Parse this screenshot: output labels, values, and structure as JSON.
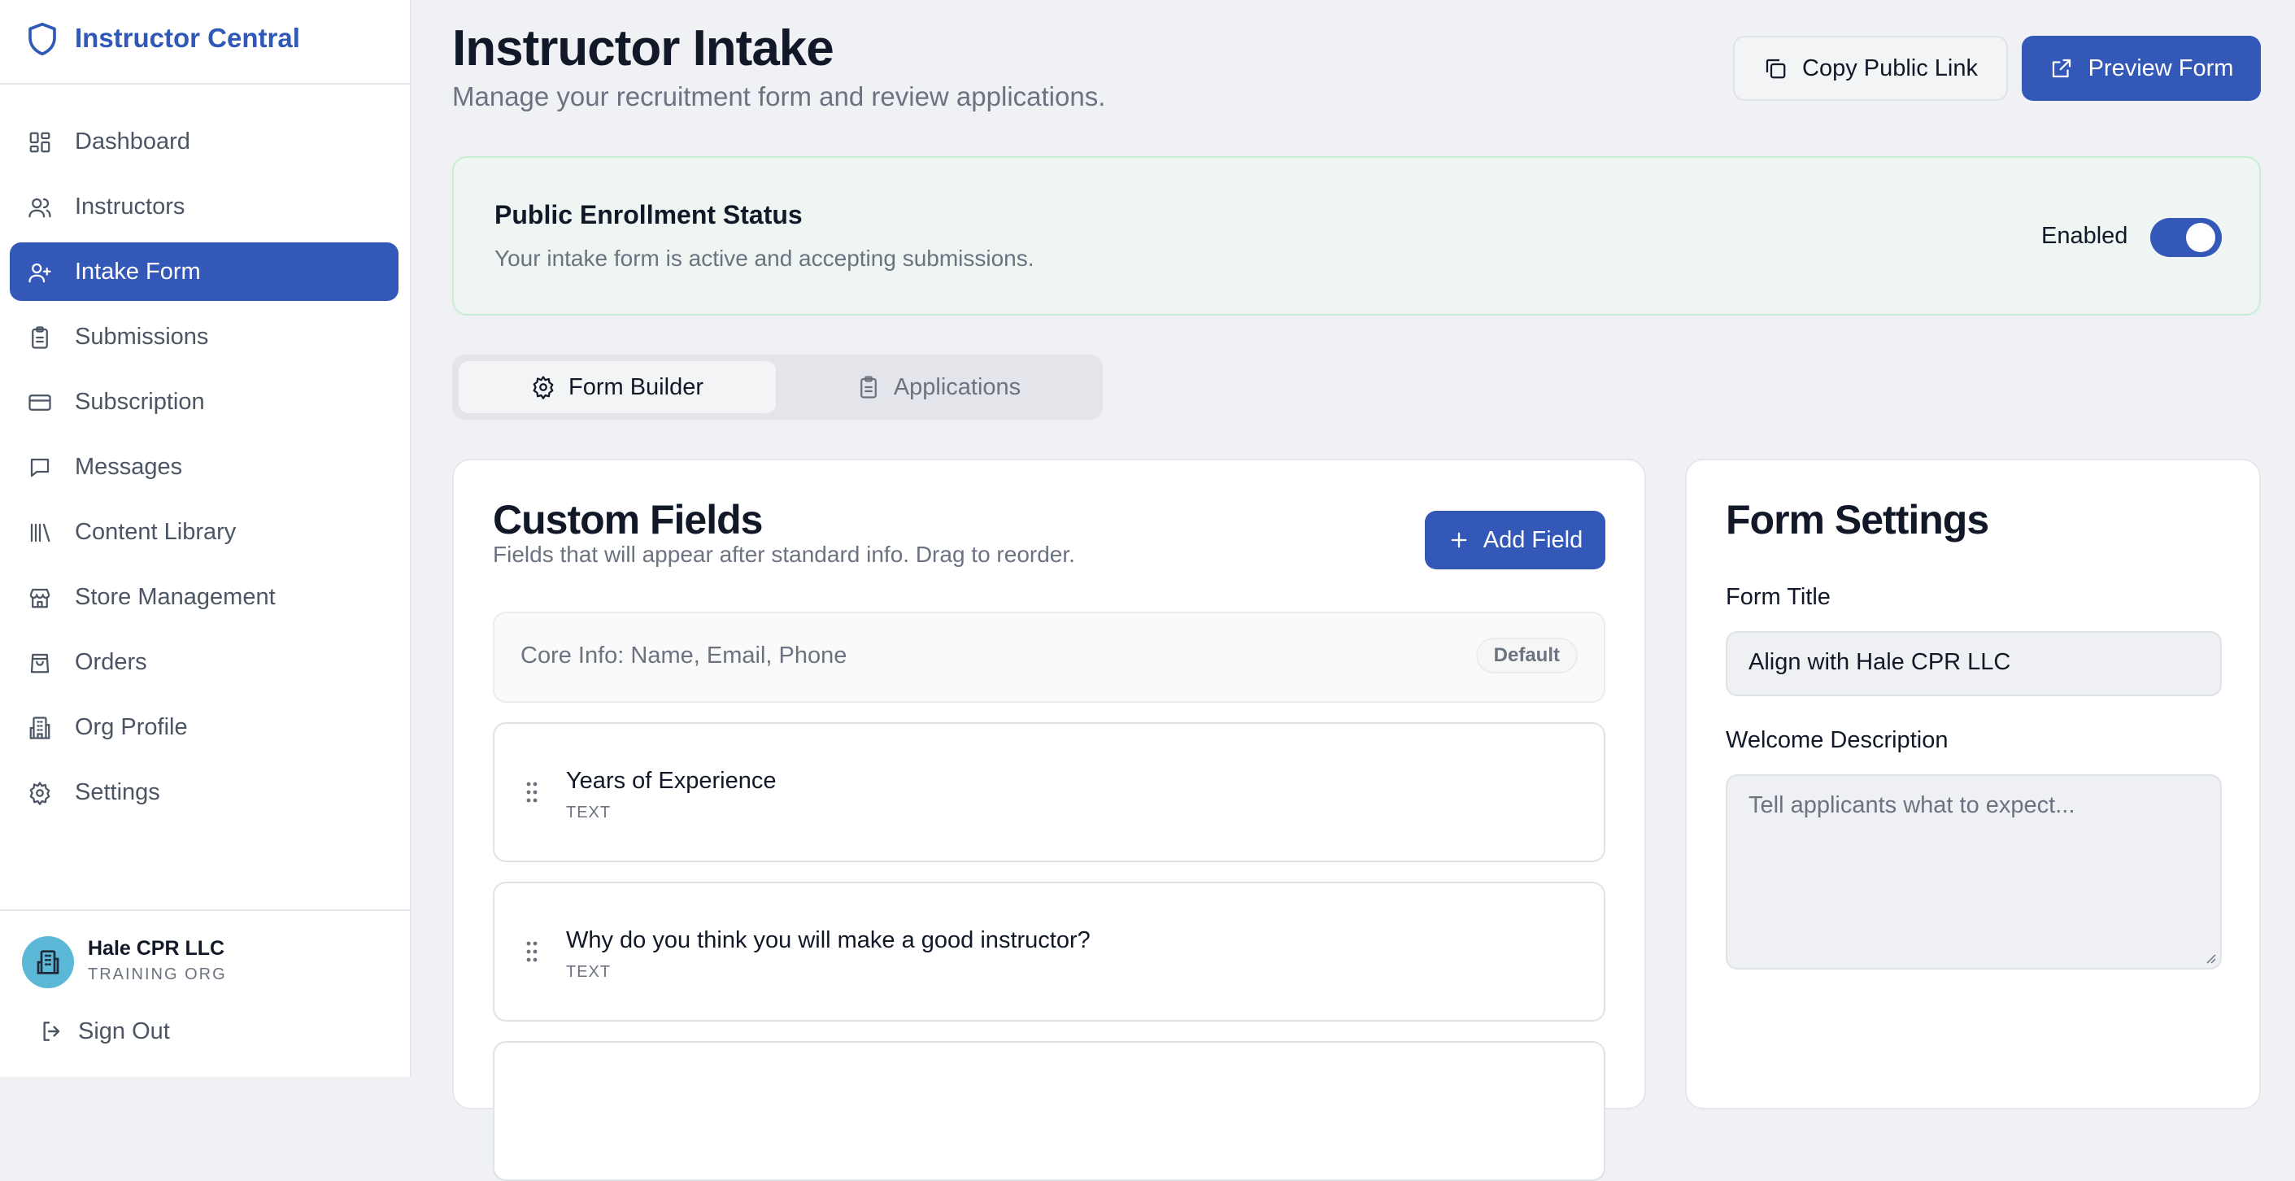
{
  "brand": {
    "name": "Instructor Central"
  },
  "sidebar": {
    "items": [
      {
        "label": "Dashboard",
        "icon": "dashboard-icon",
        "active": false
      },
      {
        "label": "Instructors",
        "icon": "users-icon",
        "active": false
      },
      {
        "label": "Intake Form",
        "icon": "user-plus-icon",
        "active": true
      },
      {
        "label": "Submissions",
        "icon": "clipboard-icon",
        "active": false
      },
      {
        "label": "Subscription",
        "icon": "credit-card-icon",
        "active": false
      },
      {
        "label": "Messages",
        "icon": "message-icon",
        "active": false
      },
      {
        "label": "Content Library",
        "icon": "library-icon",
        "active": false
      },
      {
        "label": "Store Management",
        "icon": "store-icon",
        "active": false
      },
      {
        "label": "Orders",
        "icon": "shopping-bag-icon",
        "active": false
      },
      {
        "label": "Org Profile",
        "icon": "building-icon",
        "active": false
      },
      {
        "label": "Settings",
        "icon": "gear-icon",
        "active": false
      }
    ],
    "org": {
      "name": "Hale CPR LLC",
      "type": "TRAINING ORG"
    },
    "sign_out": "Sign Out"
  },
  "header": {
    "title": "Instructor Intake",
    "subtitle": "Manage your recruitment form and review applications.",
    "copy_link": "Copy Public Link",
    "preview": "Preview Form"
  },
  "status": {
    "title": "Public Enrollment Status",
    "description": "Your intake form is active and accepting submissions.",
    "toggle_label": "Enabled",
    "enabled": true
  },
  "tabs": [
    {
      "label": "Form Builder",
      "active": true
    },
    {
      "label": "Applications",
      "active": false
    }
  ],
  "fields_card": {
    "title": "Custom Fields",
    "subtitle": "Fields that will appear after standard info. Drag to reorder.",
    "add_button": "Add Field",
    "core": {
      "text": "Core Info: Name, Email, Phone",
      "badge": "Default"
    },
    "fields": [
      {
        "label": "Years of Experience",
        "type": "TEXT"
      },
      {
        "label": "Why do you think you will make a good instructor?",
        "type": "TEXT"
      }
    ]
  },
  "settings_card": {
    "title": "Form Settings",
    "form_title_label": "Form Title",
    "form_title_value": "Align with Hale CPR LLC",
    "welcome_label": "Welcome Description",
    "welcome_placeholder": "Tell applicants what to expect..."
  },
  "colors": {
    "accent": "#3358b8",
    "brand_text": "#2f58b8",
    "status_bg": "#eef5f2",
    "status_border": "#c9ecd4",
    "avatar": "#5cb8d7"
  }
}
